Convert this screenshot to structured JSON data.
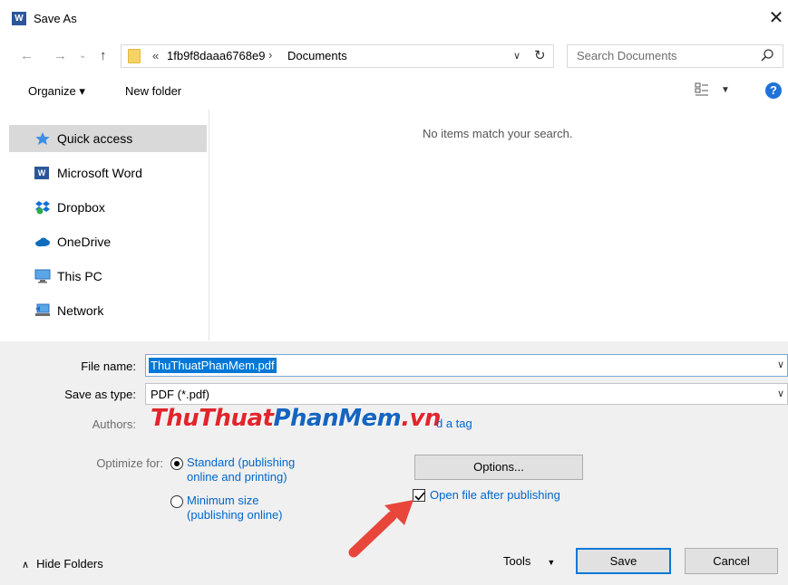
{
  "window": {
    "title": "Save As",
    "app_icon_letter": "W",
    "close_glyph": "✕"
  },
  "nav": {
    "back_icon": "back-arrow-icon",
    "forward_icon": "forward-arrow-icon",
    "up_icon": "up-arrow-icon",
    "address": {
      "chevrons": "«",
      "root": "1fb9f8daaa6768e9",
      "separator": "›",
      "current": "Documents"
    },
    "search": {
      "placeholder": "Search Documents"
    }
  },
  "toolbar": {
    "organize_label": "Organize ▾",
    "new_folder_label": "New folder",
    "help_label": "?"
  },
  "sidebar": {
    "items": [
      {
        "label": "Quick access",
        "icon": "star-icon",
        "selected": true
      },
      {
        "label": "Microsoft Word",
        "icon": "word-icon",
        "selected": false
      },
      {
        "label": "Dropbox",
        "icon": "dropbox-icon",
        "selected": false
      },
      {
        "label": "OneDrive",
        "icon": "onedrive-icon",
        "selected": false
      },
      {
        "label": "This PC",
        "icon": "computer-icon",
        "selected": false
      },
      {
        "label": "Network",
        "icon": "network-icon",
        "selected": false
      }
    ]
  },
  "content": {
    "empty_message": "No items match your search."
  },
  "form": {
    "file_name_label": "File name:",
    "file_name_value": "ThuThuatPhanMem.pdf",
    "save_type_label": "Save as type:",
    "save_type_value": "PDF (*.pdf)",
    "authors_label": "Authors:",
    "add_tag_text": "d a tag",
    "optimize_label": "Optimize for:",
    "option_standard_line1": "Standard (publishing",
    "option_standard_line2": "online and printing)",
    "option_minimum_line1": "Minimum size",
    "option_minimum_line2": "(publishing online)",
    "options_button": "Options...",
    "open_after_label": "Open file after publishing",
    "open_after_checked": true
  },
  "watermark": {
    "part1": "ThuThuat",
    "part2": "PhanMem",
    "part3": ".vn"
  },
  "footer": {
    "hide_folders_label": "Hide Folders",
    "tools_label": "Tools",
    "save_label": "Save",
    "cancel_label": "Cancel"
  },
  "colors": {
    "accent": "#0078d7",
    "link": "#0066cc",
    "arrow": "#e8463b",
    "watermark_red": "#e2252c",
    "watermark_blue": "#1565c0"
  }
}
